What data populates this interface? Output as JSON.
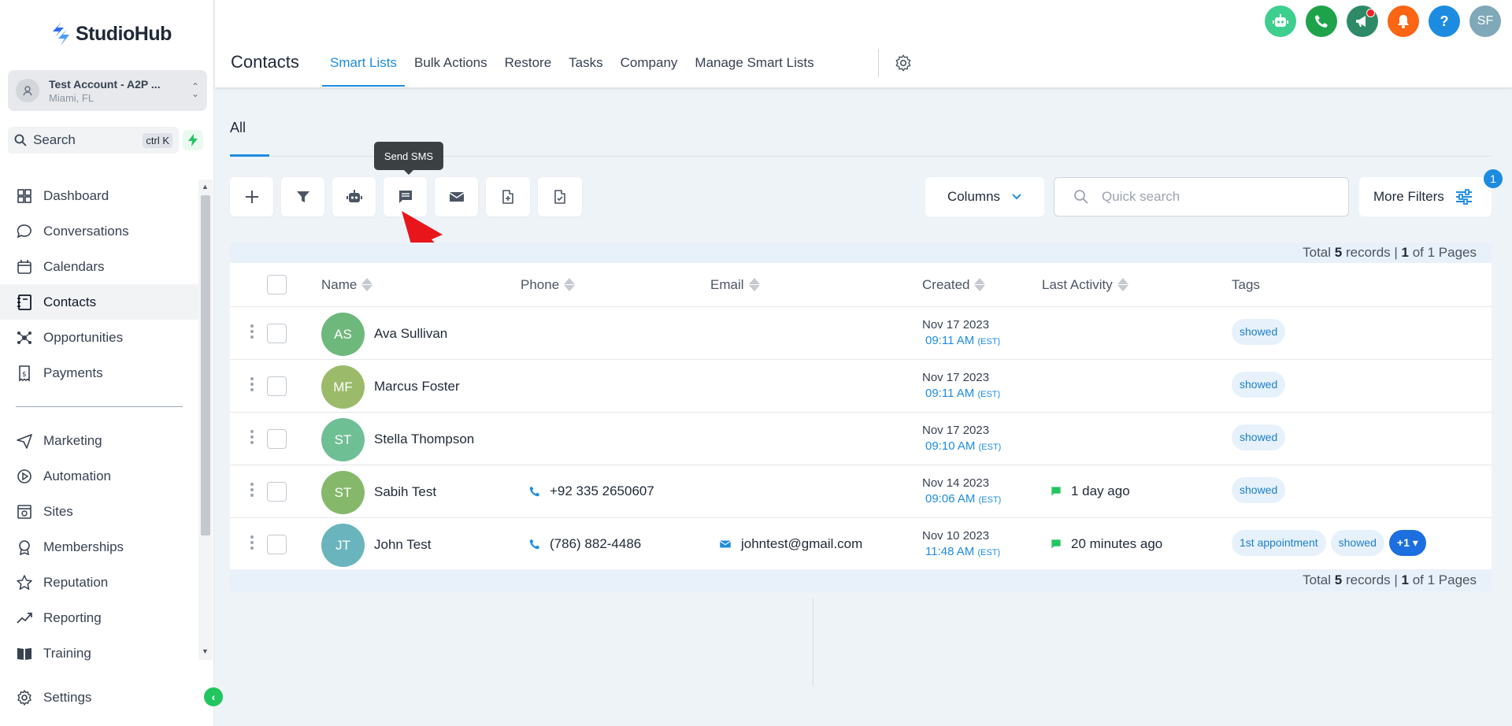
{
  "brand": {
    "name": "StudioHub"
  },
  "account": {
    "name": "Test Account - A2P ...",
    "location": "Miami, FL"
  },
  "search": {
    "label": "Search",
    "shortcut": "ctrl K"
  },
  "nav": {
    "items": [
      {
        "label": "Dashboard",
        "icon": "dashboard-icon"
      },
      {
        "label": "Conversations",
        "icon": "chat-bubble-icon"
      },
      {
        "label": "Calendars",
        "icon": "calendar-icon"
      },
      {
        "label": "Contacts",
        "icon": "contacts-book-icon",
        "active": true
      },
      {
        "label": "Opportunities",
        "icon": "opportunities-icon"
      },
      {
        "label": "Payments",
        "icon": "payments-icon"
      }
    ],
    "items2": [
      {
        "label": "Marketing",
        "icon": "send-icon"
      },
      {
        "label": "Automation",
        "icon": "automation-icon"
      },
      {
        "label": "Sites",
        "icon": "sites-icon"
      },
      {
        "label": "Memberships",
        "icon": "memberships-icon"
      },
      {
        "label": "Reputation",
        "icon": "star-icon"
      },
      {
        "label": "Reporting",
        "icon": "trend-icon"
      },
      {
        "label": "Training",
        "icon": "book-icon"
      }
    ],
    "settings": "Settings"
  },
  "header": {
    "title": "Contacts",
    "tabs": [
      "Smart Lists",
      "Bulk Actions",
      "Restore",
      "Tasks",
      "Company",
      "Manage Smart Lists"
    ],
    "active_tab": "Smart Lists",
    "user_initials": "SF",
    "help": "?"
  },
  "list_tab": "All",
  "tooltip": "Send SMS",
  "columns_label": "Columns",
  "quick_search_placeholder": "Quick search",
  "more_filters": {
    "label": "More Filters",
    "count": "1"
  },
  "summary": {
    "prefix": "Total ",
    "records": "5",
    "mid": " records | ",
    "page": "1",
    "suffix": " of 1 Pages"
  },
  "table": {
    "headers": {
      "name": "Name",
      "phone": "Phone",
      "email": "Email",
      "created": "Created",
      "last_activity": "Last Activity",
      "tags": "Tags"
    },
    "rows": [
      {
        "initials": "AS",
        "color": "#6fb87c",
        "name": "Ava Sullivan",
        "phone": "",
        "email": "",
        "created_date": "Nov 17 2023",
        "created_time": "09:11 AM",
        "tz": "(EST)",
        "activity": "",
        "tags": [
          "showed"
        ],
        "more": ""
      },
      {
        "initials": "MF",
        "color": "#9bbb6a",
        "name": "Marcus Foster",
        "phone": "",
        "email": "",
        "created_date": "Nov 17 2023",
        "created_time": "09:11 AM",
        "tz": "(EST)",
        "activity": "",
        "tags": [
          "showed"
        ],
        "more": ""
      },
      {
        "initials": "ST",
        "color": "#6fbf95",
        "name": "Stella Thompson",
        "phone": "",
        "email": "",
        "created_date": "Nov 17 2023",
        "created_time": "09:10 AM",
        "tz": "(EST)",
        "activity": "",
        "tags": [
          "showed"
        ],
        "more": ""
      },
      {
        "initials": "ST",
        "color": "#86b86c",
        "name": "Sabih Test",
        "phone": "+92 335 2650607",
        "email": "",
        "created_date": "Nov 14 2023",
        "created_time": "09:06 AM",
        "tz": "(EST)",
        "activity": "1 day ago",
        "tags": [
          "showed"
        ],
        "more": ""
      },
      {
        "initials": "JT",
        "color": "#6ab5bd",
        "name": "John Test",
        "phone": "(786) 882-4486",
        "email": "johntest@gmail.com",
        "created_date": "Nov 10 2023",
        "created_time": "11:48 AM",
        "tz": "(EST)",
        "activity": "20 minutes ago",
        "tags": [
          "1st appointment",
          "showed"
        ],
        "more": "+1"
      }
    ]
  },
  "colors": {
    "accent": "#1d8ce0",
    "active_nav_bg": "#f1f3f5",
    "tag_bg": "#e6f1fb",
    "arrow": "#e8161b"
  }
}
